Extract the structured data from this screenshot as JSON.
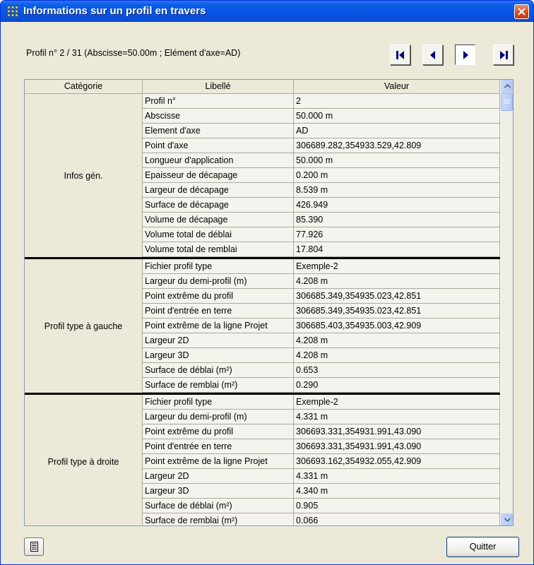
{
  "window": {
    "title": "Informations sur un profil en travers",
    "close_icon": "close-icon",
    "title_icon": "grid-app-icon"
  },
  "profil_label": "Profil n° 2 / 31 (Abscisse=50.00m ; Elément d'axe=AD)",
  "nav": [
    {
      "name": "first-profile-button",
      "icon": "first-icon"
    },
    {
      "name": "previous-profile-button",
      "icon": "previous-icon"
    },
    {
      "name": "next-profile-button",
      "icon": "next-icon"
    },
    {
      "name": "last-profile-button",
      "icon": "last-icon"
    }
  ],
  "table": {
    "headers": {
      "categorie": "Catégorie",
      "libelle": "Libellé",
      "valeur": "Valeur"
    },
    "groups": [
      {
        "category": "Infos gén.",
        "rows": [
          {
            "libelle": "Profil n°",
            "valeur": "2"
          },
          {
            "libelle": "Abscisse",
            "valeur": "50.000 m"
          },
          {
            "libelle": "Element d'axe",
            "valeur": "AD"
          },
          {
            "libelle": "Point d'axe",
            "valeur": "306689.282,354933.529,42.809"
          },
          {
            "libelle": "Longueur d'application",
            "valeur": "50.000 m"
          },
          {
            "libelle": "Epaisseur de décapage",
            "valeur": "0.200 m"
          },
          {
            "libelle": "Largeur de décapage",
            "valeur": "8.539 m"
          },
          {
            "libelle": "Surface de décapage",
            "valeur": "426.949"
          },
          {
            "libelle": "Volume de décapage",
            "valeur": "85.390"
          },
          {
            "libelle": "Volume total de déblai",
            "valeur": "77.926"
          },
          {
            "libelle": "Volume total de remblai",
            "valeur": "17.804"
          }
        ]
      },
      {
        "category": "Profil type à gauche",
        "rows": [
          {
            "libelle": "Fichier profil type",
            "valeur": "Exemple-2"
          },
          {
            "libelle": "Largeur du demi-profil (m)",
            "valeur": "4.208 m"
          },
          {
            "libelle": "Point extrême du profil",
            "valeur": "306685.349,354935.023,42.851"
          },
          {
            "libelle": "Point d'entrée en terre",
            "valeur": "306685.349,354935.023,42.851"
          },
          {
            "libelle": "Point extrême de la ligne Projet",
            "valeur": "306685.403,354935.003,42.909"
          },
          {
            "libelle": "Largeur 2D",
            "valeur": "4.208 m"
          },
          {
            "libelle": "Largeur 3D",
            "valeur": "4.208 m"
          },
          {
            "libelle": "Surface de déblai (m²)",
            "valeur": "0.653"
          },
          {
            "libelle": "Surface de remblai (m²)",
            "valeur": "0.290"
          }
        ]
      },
      {
        "category": "Profil type à droite",
        "rows": [
          {
            "libelle": "Fichier profil type",
            "valeur": "Exemple-2"
          },
          {
            "libelle": "Largeur du demi-profil (m)",
            "valeur": "4.331 m"
          },
          {
            "libelle": "Point extrême du profil",
            "valeur": "306693.331,354931.991,43.090"
          },
          {
            "libelle": "Point d'entrée en terre",
            "valeur": "306693.331,354931.991,43.090"
          },
          {
            "libelle": "Point extrême de la ligne Projet",
            "valeur": "306693.162,354932.055,42.909"
          },
          {
            "libelle": "Largeur 2D",
            "valeur": "4.331 m"
          },
          {
            "libelle": "Largeur 3D",
            "valeur": "4.340 m"
          },
          {
            "libelle": "Surface de déblai (m²)",
            "valeur": "0.905"
          },
          {
            "libelle": "Surface de remblai (m²)",
            "valeur": "0.066"
          }
        ]
      }
    ]
  },
  "buttons": {
    "quitter": "Quitter",
    "report_icon": "report-icon"
  },
  "colors": {
    "titlebar": "#0a5fe6",
    "dialog_bg": "#ece9d8",
    "cell_bg": "#f4f3ee"
  }
}
